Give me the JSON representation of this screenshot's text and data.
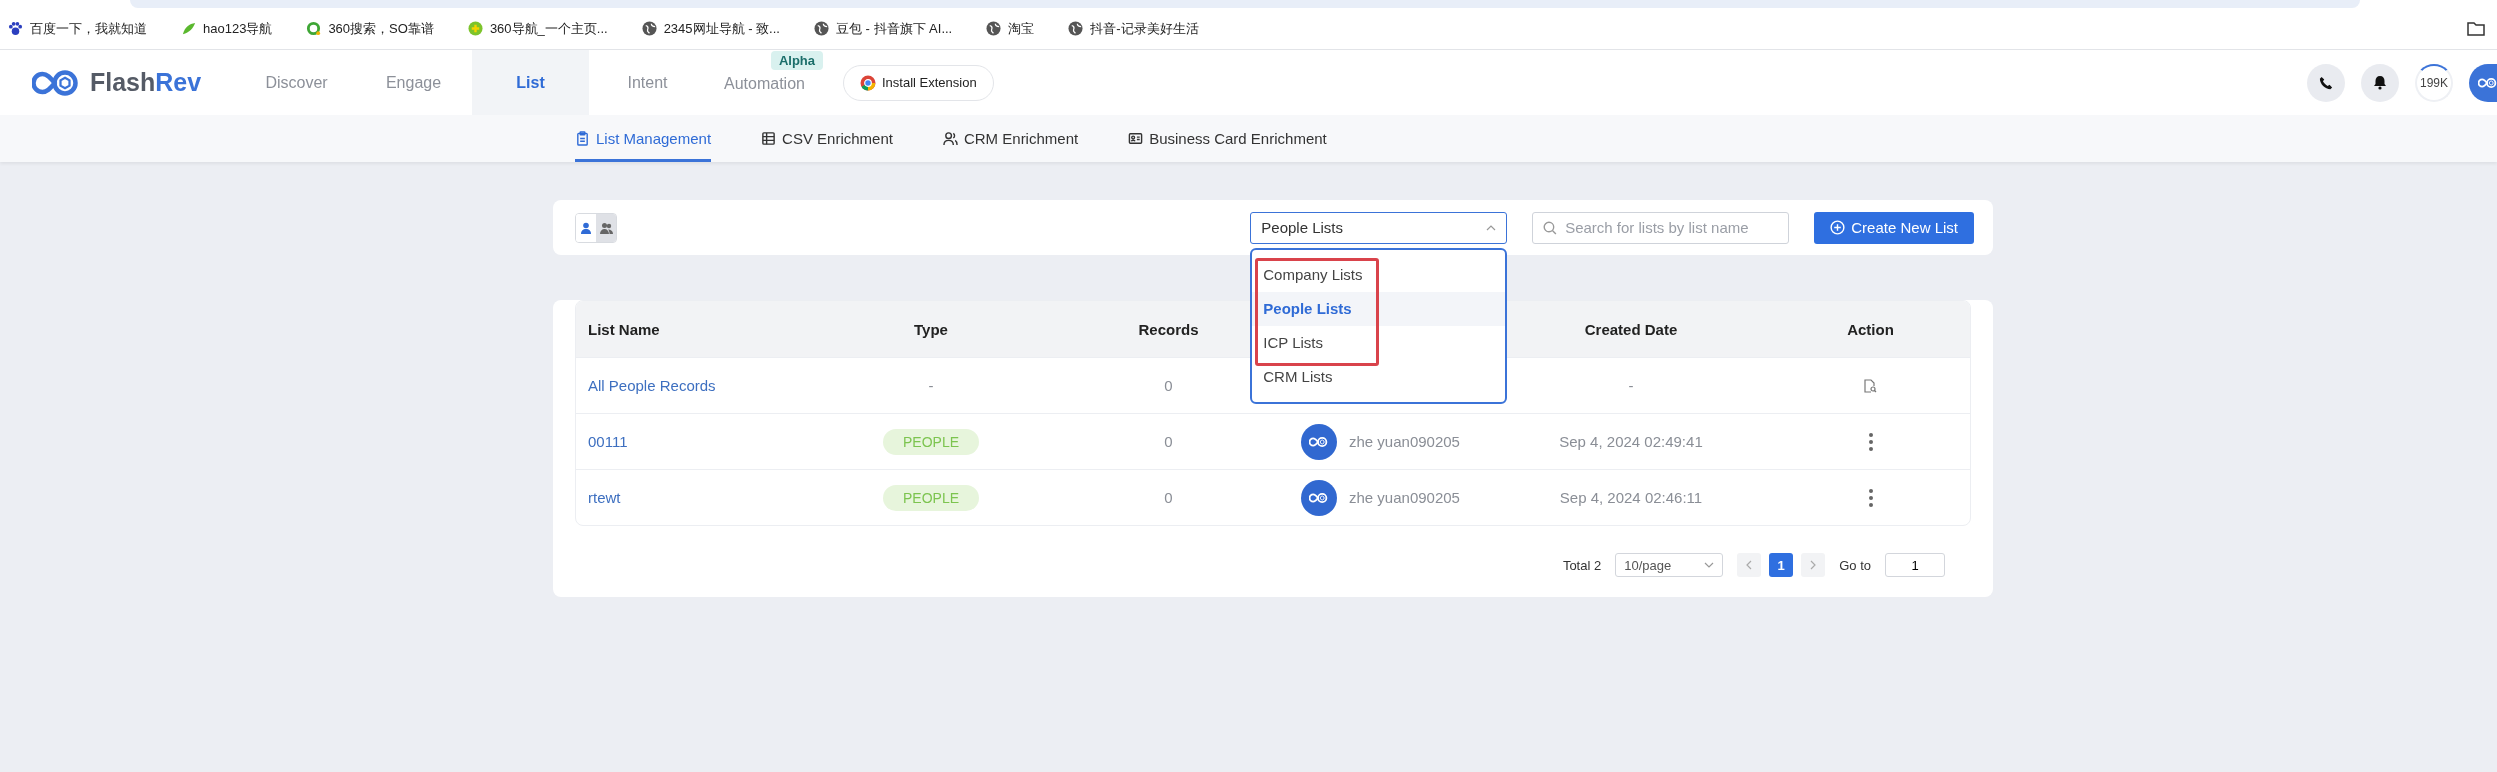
{
  "bookmarks": [
    {
      "label": "百度一下，我就知道",
      "kind": "paw"
    },
    {
      "label": "hao123导航",
      "kind": "leaf"
    },
    {
      "label": "360搜索，SO靠谱",
      "kind": "ring"
    },
    {
      "label": "360导航_一个主页...",
      "kind": "plus"
    },
    {
      "label": "2345网址导航 - 致...",
      "kind": "globe"
    },
    {
      "label": "豆包 - 抖音旗下 AI...",
      "kind": "globe"
    },
    {
      "label": "淘宝",
      "kind": "globe"
    },
    {
      "label": "抖音-记录美好生活",
      "kind": "globe"
    }
  ],
  "header": {
    "brand_a": "Flash",
    "brand_b": "Rev",
    "nav": [
      {
        "label": "Discover",
        "selected": false
      },
      {
        "label": "Engage",
        "selected": false
      },
      {
        "label": "List",
        "selected": true
      },
      {
        "label": "Intent",
        "selected": false
      },
      {
        "label": "Automation",
        "selected": false,
        "badge": "Alpha"
      }
    ],
    "install_button": "Install Extension",
    "credits": "199K"
  },
  "subnav": [
    {
      "label": "List Management",
      "selected": true,
      "kind": "clipboard"
    },
    {
      "label": "CSV Enrichment",
      "kind": "table",
      "selected": false
    },
    {
      "label": "CRM Enrichment",
      "kind": "users",
      "selected": false
    },
    {
      "label": "Business Card Enrichment",
      "kind": "card",
      "selected": false
    }
  ],
  "toolbar": {
    "view_toggle": [
      {
        "kind": "person",
        "selected": true
      },
      {
        "kind": "group",
        "selected": false
      }
    ],
    "list_type_select": {
      "value": "People Lists",
      "expanded": true,
      "options": [
        {
          "label": "Company Lists",
          "selected": false
        },
        {
          "label": "People Lists",
          "selected": true
        },
        {
          "label": "ICP Lists",
          "selected": false
        },
        {
          "label": "CRM Lists",
          "selected": false
        }
      ]
    },
    "search": {
      "placeholder": "Search for lists by list name"
    },
    "create_button": "Create New List"
  },
  "table": {
    "columns": [
      "List Name",
      "Type",
      "Records",
      "",
      "Created Date",
      "Action"
    ],
    "rows": [
      {
        "name": "All People Records",
        "type": "-",
        "records": "0",
        "owner": "",
        "created": "-",
        "kind": "view"
      },
      {
        "name": "00111",
        "type": "PEOPLE",
        "records": "0",
        "owner": "zhe yuan090205",
        "created": "Sep 4, 2024 02:49:41",
        "kind": "more"
      },
      {
        "name": "rtewt",
        "type": "PEOPLE",
        "records": "0",
        "owner": "zhe yuan090205",
        "created": "Sep 4, 2024 02:46:11",
        "kind": "more"
      }
    ]
  },
  "pagination": {
    "total": "Total 2",
    "page_size": "10/page",
    "pages": [
      {
        "label": "1",
        "selected": true
      }
    ],
    "goto_label": "Go to",
    "goto_value": "1"
  }
}
